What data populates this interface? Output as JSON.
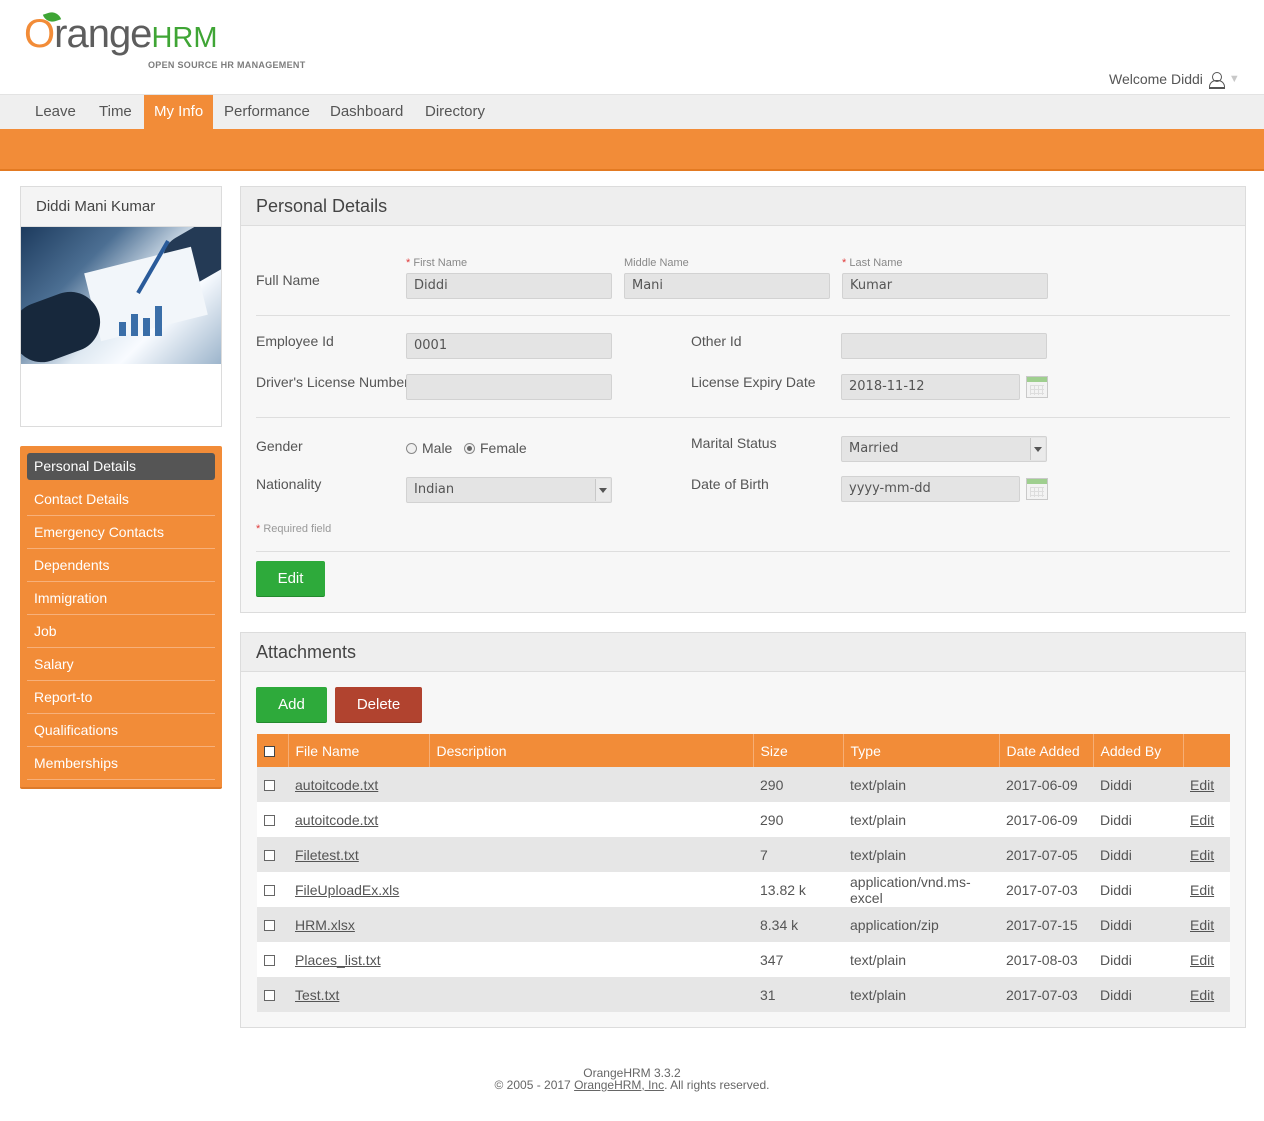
{
  "header": {
    "logo_orange": "range",
    "logo_o": "O",
    "logo_hrm": "HRM",
    "logo_tagline": "OPEN SOURCE HR MANAGEMENT",
    "welcome": "Welcome Diddi",
    "caret": "▼"
  },
  "menu": [
    "Leave",
    "Time",
    "My Info",
    "Performance",
    "Dashboard",
    "Directory"
  ],
  "menu_active": "My Info",
  "sidebar": {
    "employee_name": "Diddi Mani Kumar",
    "items": [
      "Personal Details",
      "Contact Details",
      "Emergency Contacts",
      "Dependents",
      "Immigration",
      "Job",
      "Salary",
      "Report-to",
      "Qualifications",
      "Memberships"
    ],
    "active": "Personal Details"
  },
  "personal": {
    "title": "Personal Details",
    "full_name_label": "Full Name",
    "first_name_label": "First Name",
    "middle_name_label": "Middle Name",
    "last_name_label": "Last Name",
    "first_name": "Diddi",
    "middle_name": "Mani",
    "last_name": "Kumar",
    "employee_id_label": "Employee Id",
    "employee_id": "0001",
    "other_id_label": "Other Id",
    "other_id": "",
    "license_label": "Driver's License Number",
    "license": "",
    "license_expiry_label": "License Expiry Date",
    "license_expiry": "2018-11-12",
    "gender_label": "Gender",
    "gender_male": "Male",
    "gender_female": "Female",
    "gender_selected": "Female",
    "marital_label": "Marital Status",
    "marital": "Married",
    "nationality_label": "Nationality",
    "nationality": "Indian",
    "dob_label": "Date of Birth",
    "dob_placeholder": "yyyy-mm-dd",
    "required_note": "Required field",
    "required_mark": "*",
    "edit_button": "Edit"
  },
  "attachments": {
    "title": "Attachments",
    "add_button": "Add",
    "delete_button": "Delete",
    "columns": [
      "File Name",
      "Description",
      "Size",
      "Type",
      "Date Added",
      "Added By"
    ],
    "rows": [
      {
        "file": "autoitcode.txt",
        "description": "",
        "size": "290",
        "type": "text/plain",
        "date": "2017-06-09",
        "by": "Diddi",
        "action": "Edit"
      },
      {
        "file": "autoitcode.txt",
        "description": "",
        "size": "290",
        "type": "text/plain",
        "date": "2017-06-09",
        "by": "Diddi",
        "action": "Edit"
      },
      {
        "file": "Filetest.txt",
        "description": "",
        "size": "7",
        "type": "text/plain",
        "date": "2017-07-05",
        "by": "Diddi",
        "action": "Edit"
      },
      {
        "file": "FileUploadEx.xls",
        "description": "",
        "size": "13.82 k",
        "type": "application/vnd.ms-excel",
        "date": "2017-07-03",
        "by": "Diddi",
        "action": "Edit"
      },
      {
        "file": "HRM.xlsx",
        "description": "",
        "size": "8.34 k",
        "type": "application/zip",
        "date": "2017-07-15",
        "by": "Diddi",
        "action": "Edit"
      },
      {
        "file": "Places_list.txt",
        "description": "",
        "size": "347",
        "type": "text/plain",
        "date": "2017-08-03",
        "by": "Diddi",
        "action": "Edit"
      },
      {
        "file": "Test.txt",
        "description": "",
        "size": "31",
        "type": "text/plain",
        "date": "2017-07-03",
        "by": "Diddi",
        "action": "Edit"
      }
    ]
  },
  "footer": {
    "version": "OrangeHRM 3.3.2",
    "copyright_prefix": "© 2005 - 2017 ",
    "company_link": "OrangeHRM, Inc",
    "copyright_suffix": ". All rights reserved."
  },
  "colors": {
    "accent_orange": "#f28c38",
    "button_green": "#2eaa3b",
    "button_red": "#b1432f"
  }
}
